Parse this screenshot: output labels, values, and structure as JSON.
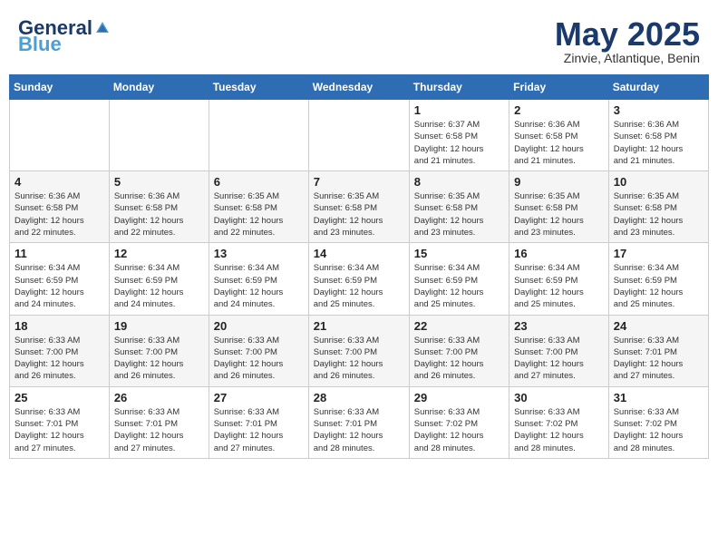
{
  "header": {
    "logo_general": "General",
    "logo_blue": "Blue",
    "month_title": "May 2025",
    "subtitle": "Zinvie, Atlantique, Benin"
  },
  "weekdays": [
    "Sunday",
    "Monday",
    "Tuesday",
    "Wednesday",
    "Thursday",
    "Friday",
    "Saturday"
  ],
  "weeks": [
    [
      {
        "day": "",
        "info": ""
      },
      {
        "day": "",
        "info": ""
      },
      {
        "day": "",
        "info": ""
      },
      {
        "day": "",
        "info": ""
      },
      {
        "day": "1",
        "info": "Sunrise: 6:37 AM\nSunset: 6:58 PM\nDaylight: 12 hours\nand 21 minutes."
      },
      {
        "day": "2",
        "info": "Sunrise: 6:36 AM\nSunset: 6:58 PM\nDaylight: 12 hours\nand 21 minutes."
      },
      {
        "day": "3",
        "info": "Sunrise: 6:36 AM\nSunset: 6:58 PM\nDaylight: 12 hours\nand 21 minutes."
      }
    ],
    [
      {
        "day": "4",
        "info": "Sunrise: 6:36 AM\nSunset: 6:58 PM\nDaylight: 12 hours\nand 22 minutes."
      },
      {
        "day": "5",
        "info": "Sunrise: 6:36 AM\nSunset: 6:58 PM\nDaylight: 12 hours\nand 22 minutes."
      },
      {
        "day": "6",
        "info": "Sunrise: 6:35 AM\nSunset: 6:58 PM\nDaylight: 12 hours\nand 22 minutes."
      },
      {
        "day": "7",
        "info": "Sunrise: 6:35 AM\nSunset: 6:58 PM\nDaylight: 12 hours\nand 23 minutes."
      },
      {
        "day": "8",
        "info": "Sunrise: 6:35 AM\nSunset: 6:58 PM\nDaylight: 12 hours\nand 23 minutes."
      },
      {
        "day": "9",
        "info": "Sunrise: 6:35 AM\nSunset: 6:58 PM\nDaylight: 12 hours\nand 23 minutes."
      },
      {
        "day": "10",
        "info": "Sunrise: 6:35 AM\nSunset: 6:58 PM\nDaylight: 12 hours\nand 23 minutes."
      }
    ],
    [
      {
        "day": "11",
        "info": "Sunrise: 6:34 AM\nSunset: 6:59 PM\nDaylight: 12 hours\nand 24 minutes."
      },
      {
        "day": "12",
        "info": "Sunrise: 6:34 AM\nSunset: 6:59 PM\nDaylight: 12 hours\nand 24 minutes."
      },
      {
        "day": "13",
        "info": "Sunrise: 6:34 AM\nSunset: 6:59 PM\nDaylight: 12 hours\nand 24 minutes."
      },
      {
        "day": "14",
        "info": "Sunrise: 6:34 AM\nSunset: 6:59 PM\nDaylight: 12 hours\nand 25 minutes."
      },
      {
        "day": "15",
        "info": "Sunrise: 6:34 AM\nSunset: 6:59 PM\nDaylight: 12 hours\nand 25 minutes."
      },
      {
        "day": "16",
        "info": "Sunrise: 6:34 AM\nSunset: 6:59 PM\nDaylight: 12 hours\nand 25 minutes."
      },
      {
        "day": "17",
        "info": "Sunrise: 6:34 AM\nSunset: 6:59 PM\nDaylight: 12 hours\nand 25 minutes."
      }
    ],
    [
      {
        "day": "18",
        "info": "Sunrise: 6:33 AM\nSunset: 7:00 PM\nDaylight: 12 hours\nand 26 minutes."
      },
      {
        "day": "19",
        "info": "Sunrise: 6:33 AM\nSunset: 7:00 PM\nDaylight: 12 hours\nand 26 minutes."
      },
      {
        "day": "20",
        "info": "Sunrise: 6:33 AM\nSunset: 7:00 PM\nDaylight: 12 hours\nand 26 minutes."
      },
      {
        "day": "21",
        "info": "Sunrise: 6:33 AM\nSunset: 7:00 PM\nDaylight: 12 hours\nand 26 minutes."
      },
      {
        "day": "22",
        "info": "Sunrise: 6:33 AM\nSunset: 7:00 PM\nDaylight: 12 hours\nand 26 minutes."
      },
      {
        "day": "23",
        "info": "Sunrise: 6:33 AM\nSunset: 7:00 PM\nDaylight: 12 hours\nand 27 minutes."
      },
      {
        "day": "24",
        "info": "Sunrise: 6:33 AM\nSunset: 7:01 PM\nDaylight: 12 hours\nand 27 minutes."
      }
    ],
    [
      {
        "day": "25",
        "info": "Sunrise: 6:33 AM\nSunset: 7:01 PM\nDaylight: 12 hours\nand 27 minutes."
      },
      {
        "day": "26",
        "info": "Sunrise: 6:33 AM\nSunset: 7:01 PM\nDaylight: 12 hours\nand 27 minutes."
      },
      {
        "day": "27",
        "info": "Sunrise: 6:33 AM\nSunset: 7:01 PM\nDaylight: 12 hours\nand 27 minutes."
      },
      {
        "day": "28",
        "info": "Sunrise: 6:33 AM\nSunset: 7:01 PM\nDaylight: 12 hours\nand 28 minutes."
      },
      {
        "day": "29",
        "info": "Sunrise: 6:33 AM\nSunset: 7:02 PM\nDaylight: 12 hours\nand 28 minutes."
      },
      {
        "day": "30",
        "info": "Sunrise: 6:33 AM\nSunset: 7:02 PM\nDaylight: 12 hours\nand 28 minutes."
      },
      {
        "day": "31",
        "info": "Sunrise: 6:33 AM\nSunset: 7:02 PM\nDaylight: 12 hours\nand 28 minutes."
      }
    ]
  ]
}
